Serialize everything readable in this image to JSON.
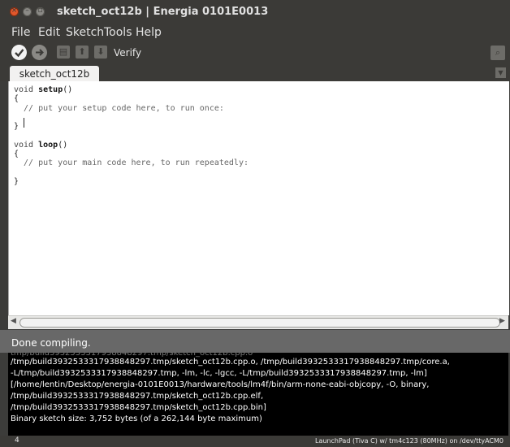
{
  "window": {
    "title": "sketch_oct12b | Energia 0101E0013"
  },
  "menubar": {
    "items": [
      "File",
      "Edit",
      "Sketch",
      "Tools",
      "Help"
    ]
  },
  "toolbar": {
    "hover_label": "Verify"
  },
  "tabs": [
    {
      "label": "sketch_oct12b"
    }
  ],
  "editor": {
    "lines": [
      {
        "kw": "void",
        "fn": "setup",
        "rest": "()"
      },
      {
        "text": "{"
      },
      {
        "comment": "  // put your setup code here, to run once:"
      },
      {
        "text": ""
      },
      {
        "text": "}"
      },
      {
        "text": ""
      },
      {
        "kw": "void",
        "fn": "loop",
        "rest": "()"
      },
      {
        "text": "{"
      },
      {
        "comment": "  // put your main code here, to run repeatedly:"
      },
      {
        "text": ""
      },
      {
        "text": "}"
      }
    ]
  },
  "status": {
    "message": "Done compiling."
  },
  "console": {
    "lines": [
      "/tmp/build3932533317938848297.tmp/sketch_oct12b.cpp.o, /tmp/build3932533317938848297.tmp/core.a,",
      "-L/tmp/build3932533317938848297.tmp, -lm, -lc, -lgcc, -L/tmp/build3932533317938848297.tmp, -lm]",
      "[/home/lentin/Desktop/energia-0101E0013/hardware/tools/lm4f/bin/arm-none-eabi-objcopy, -O, binary,",
      "/tmp/build3932533317938848297.tmp/sketch_oct12b.cpp.elf,",
      "/tmp/build3932533317938848297.tmp/sketch_oct12b.cpp.bin]",
      "Binary sketch size: 3,752 bytes (of a 262,144 byte maximum)"
    ]
  },
  "footer": {
    "line_number": "4",
    "board": "LaunchPad (Tiva C) w/ tm4c123 (80MHz) on /dev/ttyACM0"
  },
  "colors": {
    "window_chrome": "#3b3a37",
    "status_bar": "#686868",
    "console_bg": "#000000",
    "close_button": "#e2572b"
  }
}
